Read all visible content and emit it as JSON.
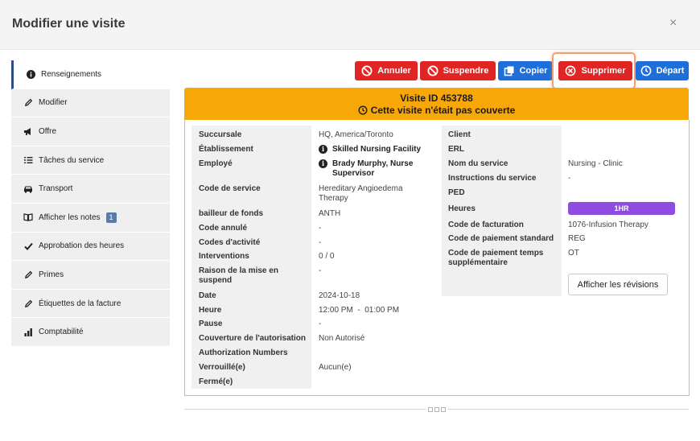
{
  "dialog": {
    "title": "Modifier une visite",
    "close_glyph": "×"
  },
  "sidebar": {
    "items": [
      {
        "label": "Renseignements",
        "icon": "info-icon"
      },
      {
        "label": "Modifier",
        "icon": "pencil-icon"
      },
      {
        "label": "Offre",
        "icon": "megaphone-icon"
      },
      {
        "label": "Tâches du service",
        "icon": "checklist-icon"
      },
      {
        "label": "Transport",
        "icon": "car-icon"
      },
      {
        "label": "Afficher les notes",
        "icon": "book-icon",
        "badge": "1"
      },
      {
        "label": "Approbation des heures",
        "icon": "check-icon"
      },
      {
        "label": "Primes",
        "icon": "pencil-icon"
      },
      {
        "label": "Étiquettes de la facture",
        "icon": "pencil-icon"
      },
      {
        "label": "Comptabilité",
        "icon": "bar-chart-icon"
      }
    ]
  },
  "toolbar": {
    "cancel_label": "Annuler",
    "suspend_label": "Suspendre",
    "copy_label": "Copier",
    "delete_label": "Supprimer",
    "depart_label": "Départ"
  },
  "banner": {
    "visit_id": "Visite ID 453788",
    "coverage": "Cette visite n'était pas couverte"
  },
  "left": [
    {
      "label": "Succursale",
      "value": "HQ, America/Toronto"
    },
    {
      "label": "Établissement",
      "value": "Skilled Nursing Facility"
    },
    {
      "label": "Employé",
      "value": "Brady Murphy, Nurse Supervisor"
    },
    {
      "label": "Code de service",
      "value": "Hereditary Angioedema Therapy"
    },
    {
      "label": "bailleur de fonds",
      "value": "ANTH"
    },
    {
      "label": "Code annulé",
      "value": "-"
    },
    {
      "label": "Codes d'activité",
      "value": "-"
    },
    {
      "label": "Interventions",
      "value": "0 / 0"
    },
    {
      "label": "Raison de la mise en suspend",
      "value": "-"
    },
    {
      "label": "Date",
      "value": "2024-10-18"
    },
    {
      "label": "Heure",
      "value": "12:00 PM  -  01:00 PM"
    },
    {
      "label": "Pause",
      "value": "-"
    },
    {
      "label": "Couverture de l'autorisation",
      "value": "Non Autorisé"
    },
    {
      "label": "Authorization Numbers",
      "value": ""
    },
    {
      "label": "Verrouillé(e)",
      "value": "Aucun(e)"
    },
    {
      "label": "Fermé(e)",
      "value": ""
    }
  ],
  "right": [
    {
      "label": "Client",
      "value": ""
    },
    {
      "label": "ERL",
      "value": ""
    },
    {
      "label": "Nom du service",
      "value": "Nursing - Clinic"
    },
    {
      "label": "Instructions du service",
      "value": "-"
    },
    {
      "label": "PED",
      "value": ""
    },
    {
      "label": "Heures",
      "value": "1HR"
    },
    {
      "label": "Code de facturation",
      "value": "1076-Infusion Therapy"
    },
    {
      "label": "Code de paiement standard",
      "value": "REG"
    },
    {
      "label": "Code de paiement temps supplémentaire",
      "value": "OT"
    }
  ],
  "revisions_label": "Afficher les révisions",
  "colors": {
    "red": "#e02525",
    "blue": "#1e6fd9",
    "banner": "#f7a708",
    "pill": "#8e4de0",
    "active": "#2c4d8a"
  }
}
